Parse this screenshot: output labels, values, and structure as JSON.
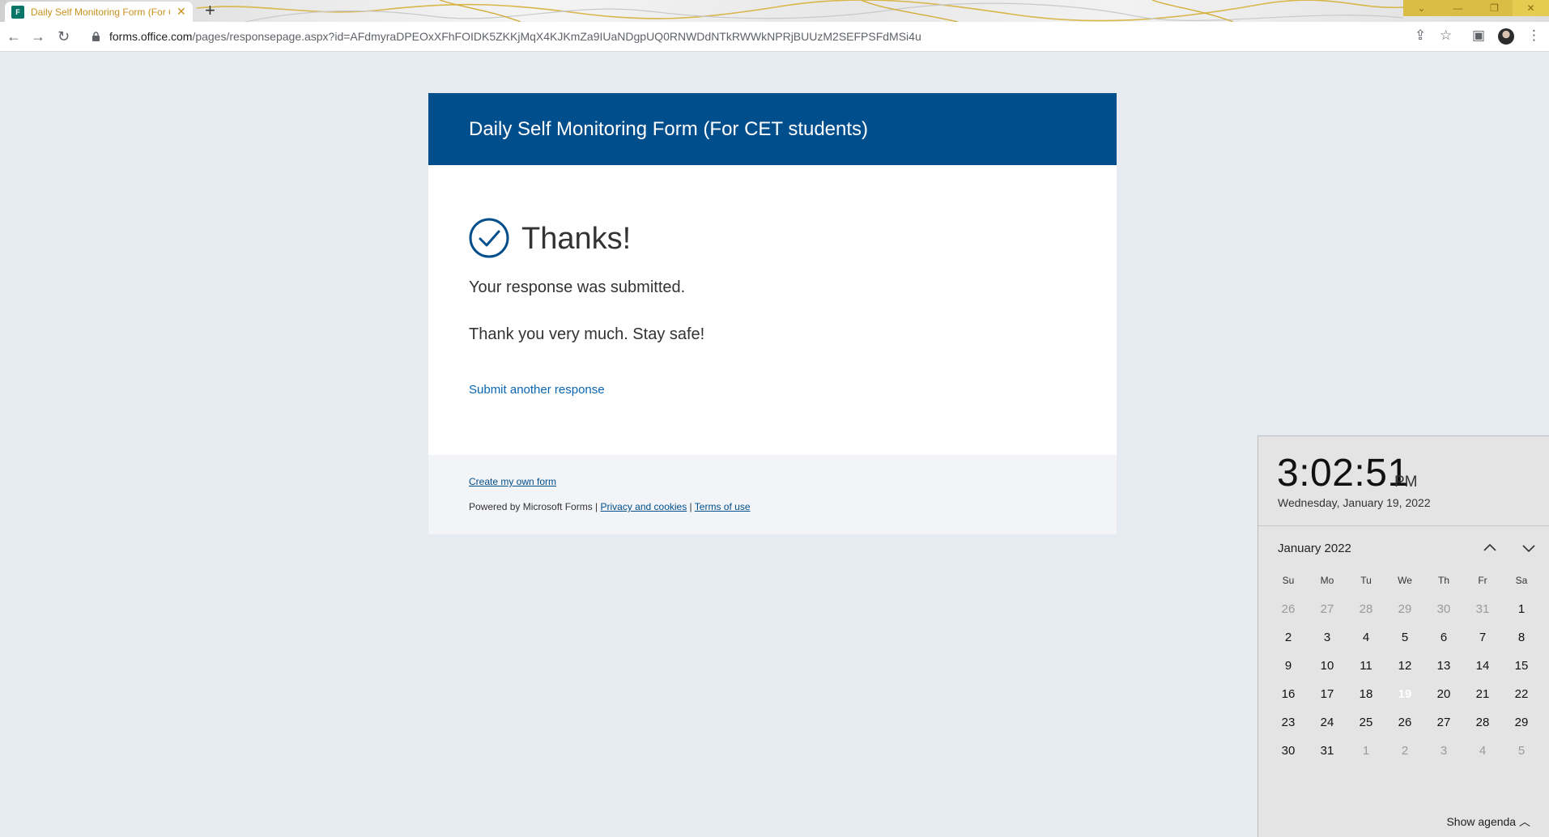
{
  "browser": {
    "tab_title": "Daily Self Monitoring Form (For C",
    "url_domain": "forms.office.com",
    "url_path": "/pages/responsepage.aspx?id=AFdmyraDPEOxXFhFOIDK5ZKKjMqX4KJKmZa9IUaNDgpUQ0RNWDdNTkRWWkNPRjBUUzM2SEFPSFdMSi4u"
  },
  "form": {
    "header_title": "Daily Self Monitoring Form (For CET students)",
    "thanks": "Thanks!",
    "submitted_msg": "Your response was submitted.",
    "closing_msg": "Thank you very much. Stay safe!",
    "submit_another": "Submit another response"
  },
  "footer": {
    "create_link": "Create my own form",
    "powered_by": "Powered by Microsoft Forms | ",
    "privacy_link": "Privacy and cookies",
    "separator": " | ",
    "terms_link": "Terms of use"
  },
  "clock": {
    "time": "3:02:51",
    "ampm": "PM",
    "date": "Wednesday, January 19, 2022",
    "month_label": "January 2022",
    "weekdays": [
      "Su",
      "Mo",
      "Tu",
      "We",
      "Th",
      "Fr",
      "Sa"
    ],
    "weeks": [
      [
        "26",
        "27",
        "28",
        "29",
        "30",
        "31",
        "1"
      ],
      [
        "2",
        "3",
        "4",
        "5",
        "6",
        "7",
        "8"
      ],
      [
        "9",
        "10",
        "11",
        "12",
        "13",
        "14",
        "15"
      ],
      [
        "16",
        "17",
        "18",
        "19",
        "20",
        "21",
        "22"
      ],
      [
        "23",
        "24",
        "25",
        "26",
        "27",
        "28",
        "29"
      ],
      [
        "30",
        "31",
        "1",
        "2",
        "3",
        "4",
        "5"
      ]
    ],
    "selected_day": "19",
    "show_agenda": "Show agenda"
  },
  "colors": {
    "header_bg": "#004e8c",
    "link": "#0a66b3",
    "today_bg": "#5b6e8d"
  }
}
